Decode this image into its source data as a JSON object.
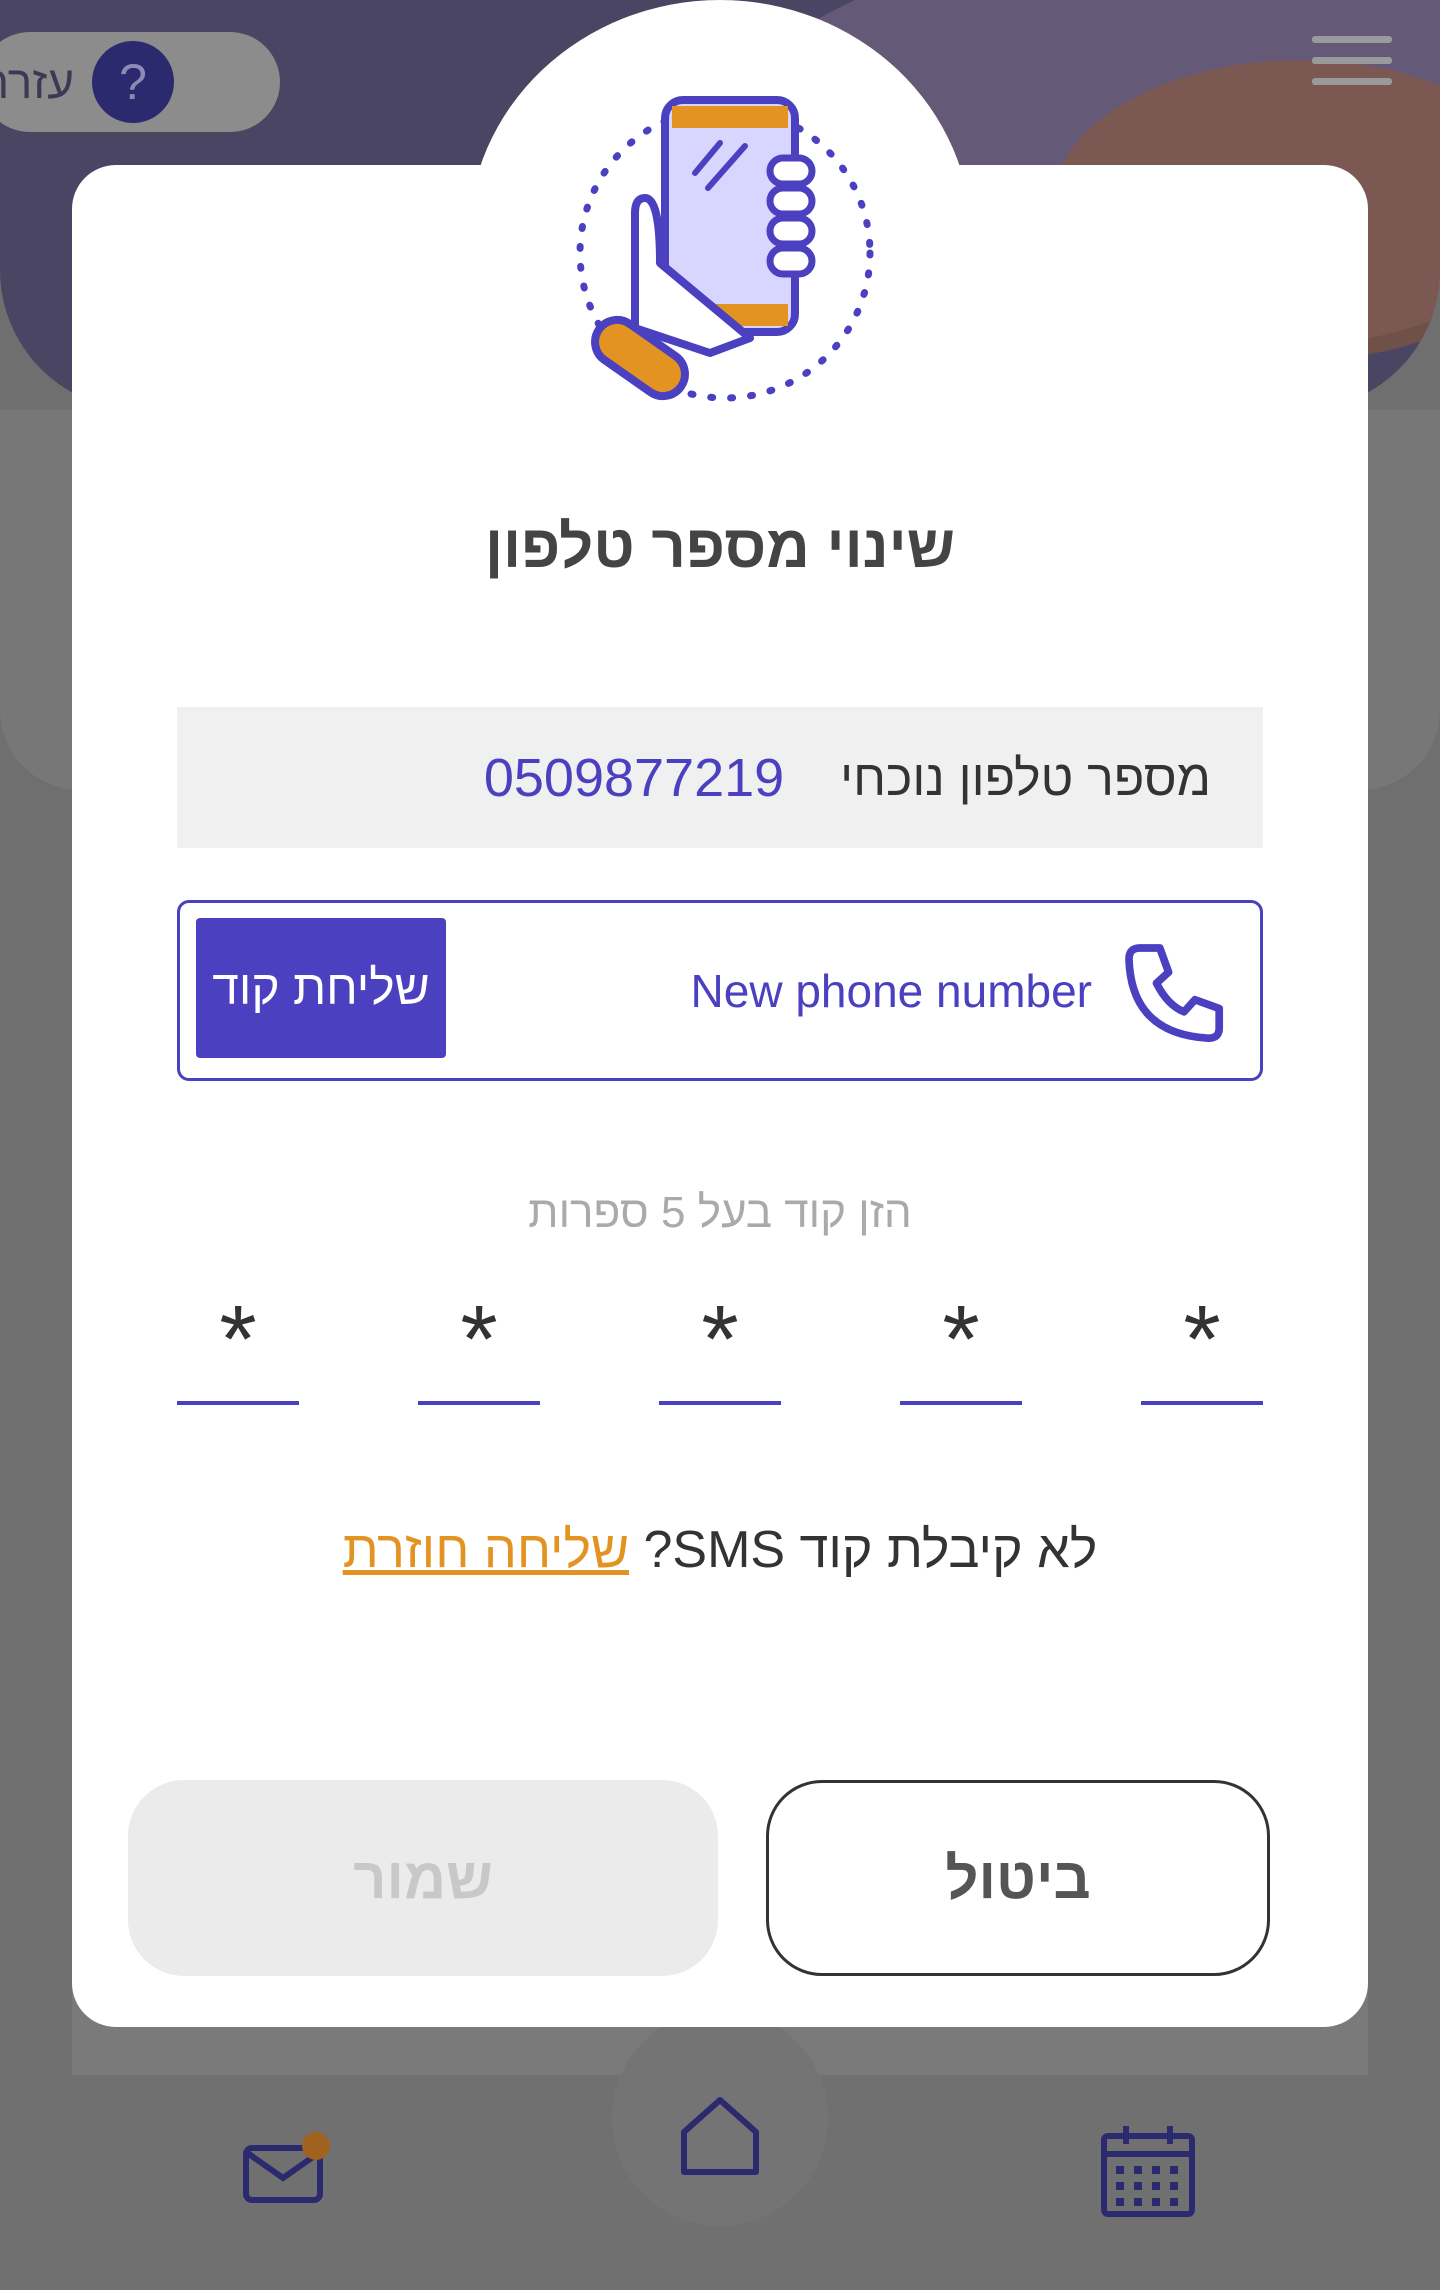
{
  "header": {
    "help_label": "עזרה",
    "help_icon_glyph": "?"
  },
  "modal": {
    "title": "שינוי מספר טלפון",
    "current_phone": {
      "label": "מספר טלפון נוכחי",
      "value": "0509877219"
    },
    "new_phone": {
      "placeholder": "New phone number",
      "send_code_label": "שליחת קוד"
    },
    "code_hint": "הזן קוד בעל 5 ספרות",
    "otp_digits": [
      "*",
      "*",
      "*",
      "*",
      "*"
    ],
    "resend": {
      "question": "לא קיבלת קוד SMS?",
      "link": "שליחה חוזרת"
    },
    "buttons": {
      "save": "שמור",
      "cancel": "ביטול"
    }
  },
  "bottom_nav": {
    "items": [
      "mail-icon",
      "home-icon",
      "calendar-icon"
    ],
    "notification_dot": true
  },
  "colors": {
    "primary": "#4b40c0",
    "accent": "#e39321",
    "text": "#333333"
  }
}
